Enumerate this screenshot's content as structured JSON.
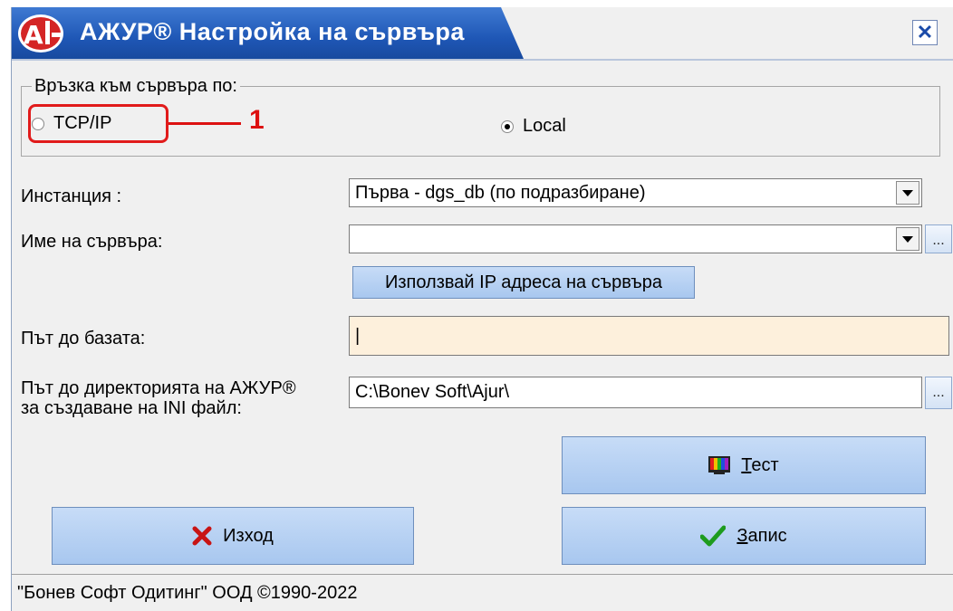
{
  "window": {
    "title": "АЖУР® Настройка на сървъра",
    "close_label": "✕",
    "accent": "#1f57b6"
  },
  "connection": {
    "group_label": "Връзка към сървъра по:",
    "options": [
      {
        "label": "TCP/IP",
        "selected": false
      },
      {
        "label": "Local",
        "selected": true
      }
    ],
    "annotation_number": "1"
  },
  "form": {
    "instance_label": "Инстанция :",
    "instance_value": "Първа - dgs_db (по подразбиране)",
    "server_name_label": "Име на сървъра:",
    "server_name_value": "",
    "ellipsis_label": "...",
    "use_ip_button": "Използвай IP адреса на сървъра",
    "db_path_label": "Път до базата:",
    "db_path_value": "|",
    "ini_dir_label_line1": "Път до директорията на АЖУР®",
    "ini_dir_label_line2": "за създаване на INI файл:",
    "ini_dir_value": "C:\\Bonev Soft\\Ajur\\"
  },
  "buttons": {
    "test_label": "Тест",
    "exit_label": "Изход",
    "save_label": "Запис"
  },
  "status": {
    "text": "\"Бонев Софт Одитинг\" ООД  ©1990-2022"
  }
}
